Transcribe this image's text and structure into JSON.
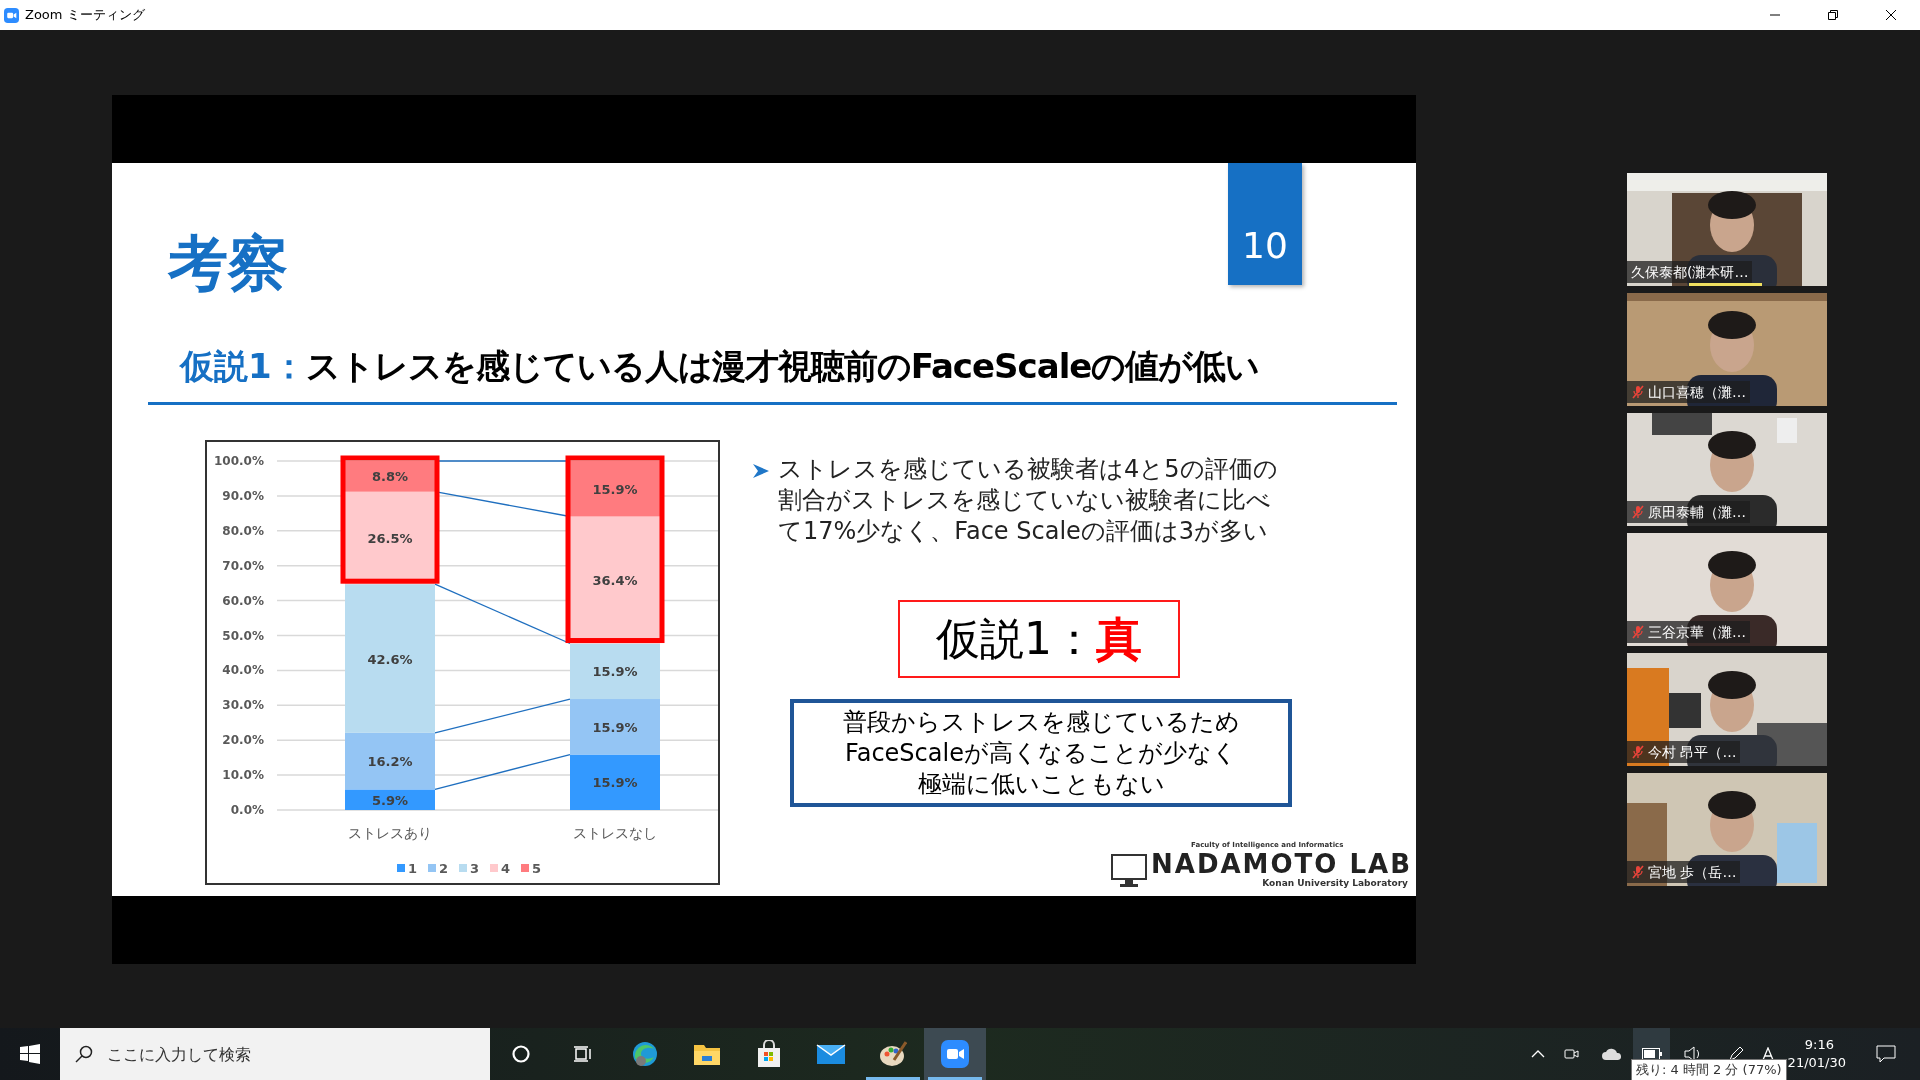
{
  "window": {
    "title": "Zoom ミーティング"
  },
  "slide": {
    "heading": "考察",
    "page_number": "10",
    "hypothesis": {
      "label": "仮説1：",
      "text": "ストレスを感じている人は漫才視聴前のFaceScaleの値が低い"
    },
    "chart": {
      "chart_data": {
        "type": "bar",
        "stacked": true,
        "orientation": "vertical",
        "categories": [
          "ストレスあり",
          "ストレスなし"
        ],
        "ylim": [
          0,
          100
        ],
        "yticks": [
          {
            "value": 0,
            "label": "0.0%"
          },
          {
            "value": 10,
            "label": "10.0%"
          },
          {
            "value": 20,
            "label": "20.0%"
          },
          {
            "value": 30,
            "label": "30.0%"
          },
          {
            "value": 40,
            "label": "40.0%"
          },
          {
            "value": 50,
            "label": "50.0%"
          },
          {
            "value": 60,
            "label": "60.0%"
          },
          {
            "value": 70,
            "label": "70.0%"
          },
          {
            "value": 80,
            "label": "80.0%"
          },
          {
            "value": 90,
            "label": "90.0%"
          },
          {
            "value": 100,
            "label": "100.0%"
          }
        ],
        "series": [
          {
            "name": "1",
            "color": "#3399ff",
            "values": [
              5.9,
              15.9
            ],
            "value_labels": [
              "5.9%",
              "15.9%"
            ]
          },
          {
            "name": "2",
            "color": "#94c5f4",
            "values": [
              16.2,
              15.9
            ],
            "value_labels": [
              "16.2%",
              "15.9%"
            ]
          },
          {
            "name": "3",
            "color": "#b8dcf0",
            "values": [
              42.6,
              15.9
            ],
            "value_labels": [
              "42.6%",
              "15.9%"
            ]
          },
          {
            "name": "4",
            "color": "#ffc9cc",
            "values": [
              26.5,
              36.4
            ],
            "value_labels": [
              "26.5%",
              "36.4%"
            ]
          },
          {
            "name": "5",
            "color": "#ff7b7f",
            "values": [
              8.8,
              15.9
            ],
            "value_labels": [
              "8.8%",
              "15.9%"
            ]
          }
        ],
        "grid": true,
        "legend": true
      },
      "series_lines": true,
      "highlight_boxes": true
    },
    "bullet": {
      "lines": [
        "ストレスを感じている被験者は4と5の評価の",
        "割合がストレスを感じていない被験者に比べ",
        "て17%少なく、Face Scaleの評価は3が多い"
      ]
    },
    "verdict": {
      "label": "仮説1：",
      "value": "真"
    },
    "conclusion": {
      "lines": [
        "普段からストレスを感じているため",
        "FaceScaleが高くなることが少なく",
        "極端に低いこともない"
      ]
    },
    "logo": {
      "name": "NADAMOTO LAB",
      "tagline": "Faculty of Intelligence and Informatics",
      "subtitle": "Konan University Laboratory"
    }
  },
  "participants": [
    {
      "name": "久保泰都(灘本研…",
      "muted": false,
      "speaking": true
    },
    {
      "name": "山口喜穂（灘…",
      "muted": true,
      "speaking": false
    },
    {
      "name": "原田泰輔（灘…",
      "muted": true,
      "speaking": false
    },
    {
      "name": "三谷京華（灘…",
      "muted": true,
      "speaking": false
    },
    {
      "name": "今村 昂平（…",
      "muted": true,
      "speaking": false
    },
    {
      "name": "宮地 歩（岳…",
      "muted": true,
      "speaking": false
    }
  ],
  "taskbar": {
    "search": {
      "placeholder": "ここに入力して検索"
    },
    "apps": [
      {
        "kind": "cortana",
        "running": false,
        "selected": false
      },
      {
        "kind": "taskview",
        "running": false,
        "selected": false
      },
      {
        "kind": "edge",
        "running": false,
        "selected": false
      },
      {
        "kind": "explorer",
        "running": false,
        "selected": false
      },
      {
        "kind": "store",
        "running": false,
        "selected": false
      },
      {
        "kind": "mail",
        "running": false,
        "selected": false
      },
      {
        "kind": "paint",
        "running": true,
        "selected": false
      },
      {
        "kind": "zoom",
        "running": true,
        "selected": true
      }
    ],
    "time": "9:16",
    "date": "21/01/30",
    "tooltip": "残り: 4 時間 2 分 (77%)"
  }
}
